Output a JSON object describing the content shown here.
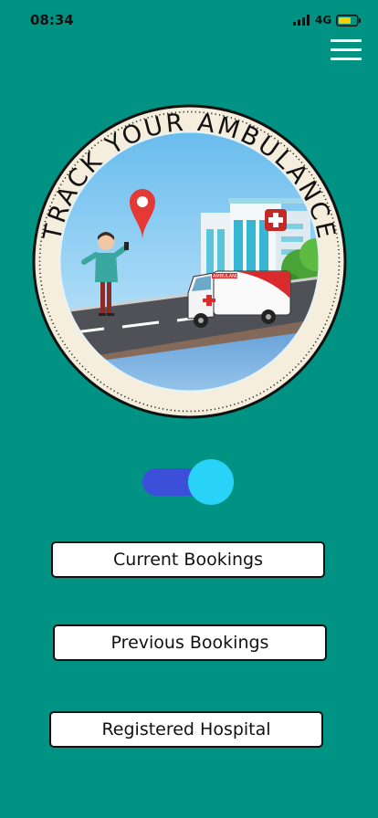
{
  "status_bar": {
    "time": "08:34",
    "network": "4G",
    "battery_color": "#f5d000"
  },
  "hero": {
    "badge_text": "TRACK YOUR AMBULANCE",
    "vehicle_label": "AMBULANCE",
    "icons": [
      "map-pin-icon",
      "hospital-building",
      "ambulance-icon",
      "person-with-phone"
    ]
  },
  "toggle": {
    "state": "on",
    "track_color": "#3c4fd8",
    "knob_color": "#28d3f7"
  },
  "buttons": {
    "current_bookings": "Current Bookings",
    "previous_bookings": "Previous Bookings",
    "registered_hospital": "Registered Hospital"
  },
  "theme": {
    "background": "#009383"
  }
}
